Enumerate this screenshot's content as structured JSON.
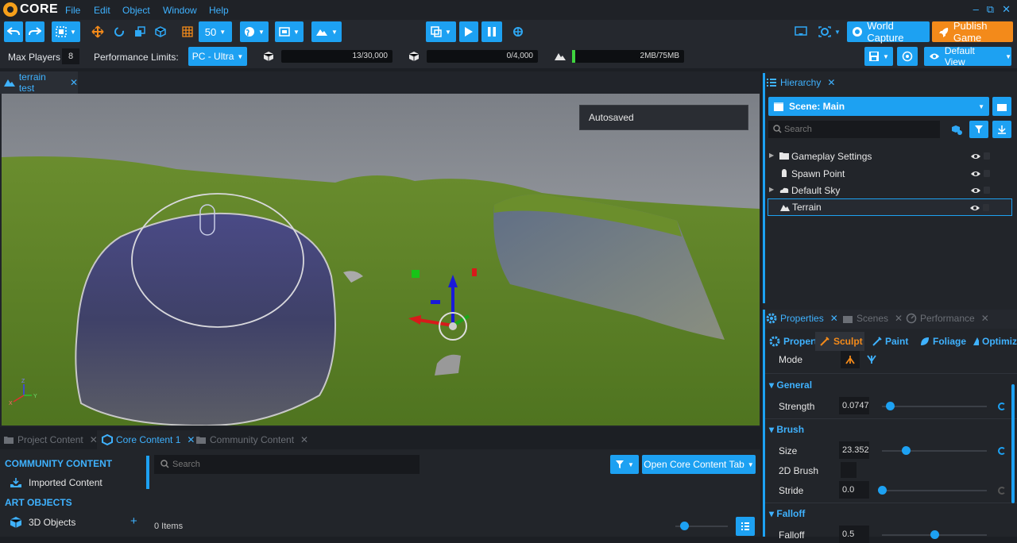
{
  "app": {
    "logo_text": "CORE"
  },
  "menu": {
    "file": "File",
    "edit": "Edit",
    "object": "Object",
    "window": "Window",
    "help": "Help"
  },
  "window_controls": {
    "minimize": "–",
    "restore": "⧉",
    "close": "✕"
  },
  "toolbar": {
    "grid_size": "50",
    "world_capture": "World Capture",
    "publish_game": "Publish Game",
    "default_view": "Default View"
  },
  "status": {
    "max_players_label": "Max Players",
    "max_players_value": "8",
    "perf_limits_label": "Performance Limits:",
    "perf_profile": "PC - Ultra",
    "objects_count": "13/30,000",
    "networked_count": "0/4,000",
    "memory": "2MB/75MB",
    "memory_fill": 0.02
  },
  "viewport": {
    "tab_label": "terrain test",
    "tab_close": "✕",
    "toast": "Autosaved",
    "axis_z": "Z",
    "axis_x": "X",
    "axis_y": "Y"
  },
  "hierarchy": {
    "tab_label": "Hierarchy",
    "tab_close": "✕",
    "scene_label": "Scene: Main",
    "search_placeholder": "Search",
    "items": [
      {
        "label": "Gameplay Settings",
        "expandable": true,
        "icon": "folder-icon"
      },
      {
        "label": "Spawn Point",
        "expandable": false,
        "icon": "spawn-point-icon"
      },
      {
        "label": "Default Sky",
        "expandable": true,
        "icon": "sky-icon"
      },
      {
        "label": "Terrain",
        "expandable": false,
        "icon": "terrain-icon",
        "selected": true
      }
    ]
  },
  "properties_panel": {
    "tabs": [
      {
        "label": "Properties",
        "close": "✕"
      },
      {
        "label": "Scenes",
        "close": "✕"
      },
      {
        "label": "Performance",
        "close": "✕"
      }
    ],
    "subtabs": [
      "Propert",
      "Sculpt",
      "Paint",
      "Foliage",
      "Optimiz"
    ],
    "mode_label": "Mode",
    "sections": {
      "general": "General",
      "brush": "Brush",
      "falloff": "Falloff"
    },
    "strength": {
      "label": "Strength",
      "value": "0.0747",
      "fraction": 0.075
    },
    "size": {
      "label": "Size",
      "value": "23.352",
      "fraction": 0.23
    },
    "brush2d": {
      "label": "2D Brush"
    },
    "stride": {
      "label": "Stride",
      "value": "0.0",
      "fraction": 0.0
    },
    "falloff": {
      "label": "Falloff",
      "value": "0.5",
      "fraction": 0.5
    }
  },
  "content": {
    "tabs": [
      {
        "label": "Project Content",
        "close": "✕",
        "active": false
      },
      {
        "label": "Core Content 1",
        "close": "✕",
        "active": true
      },
      {
        "label": "Community Content",
        "close": "✕",
        "active": false
      }
    ],
    "sections": [
      {
        "title": "COMMUNITY CONTENT",
        "items": [
          "Imported Content"
        ]
      },
      {
        "title": "ART OBJECTS",
        "items": [
          "3D Objects"
        ]
      }
    ],
    "add_symbol": "+",
    "search_placeholder": "Search",
    "open_button": "Open Core Content Tab",
    "items_count": "0 Items"
  },
  "colors": {
    "accent": "#1da1f2",
    "publish": "#f38a1a",
    "link": "#3fb2ff"
  }
}
